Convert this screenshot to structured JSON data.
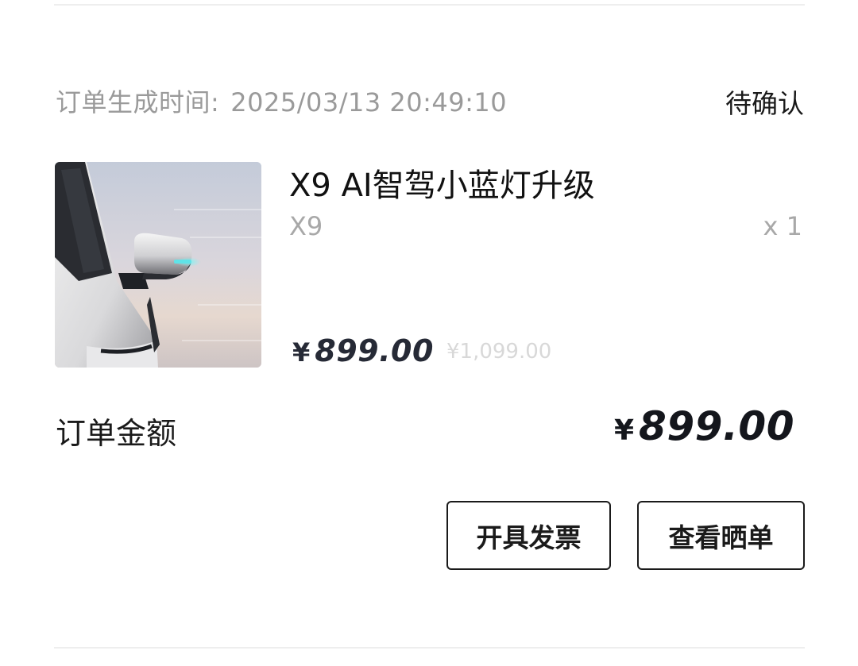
{
  "order": {
    "time_label": "订单生成时间:",
    "time_value": "2025/03/13 20:49:10",
    "status": "待确认"
  },
  "product": {
    "image_icon": "car-side-mirror-image",
    "name": "X9 AI智驾小蓝灯升级",
    "variant": "X9",
    "quantity": "x 1",
    "price_currency": "¥",
    "price": "899.00",
    "original_price": "¥1,099.00"
  },
  "total": {
    "label": "订单金额",
    "currency": "¥",
    "amount": "899.00"
  },
  "actions": {
    "invoice_label": "开具发票",
    "review_label": "查看晒单"
  },
  "colors": {
    "price": "#262a36",
    "muted_text": "#9a9a9a",
    "strikethrough_price": "#d8d8d8",
    "mirror_light": "#5fe3e8"
  }
}
